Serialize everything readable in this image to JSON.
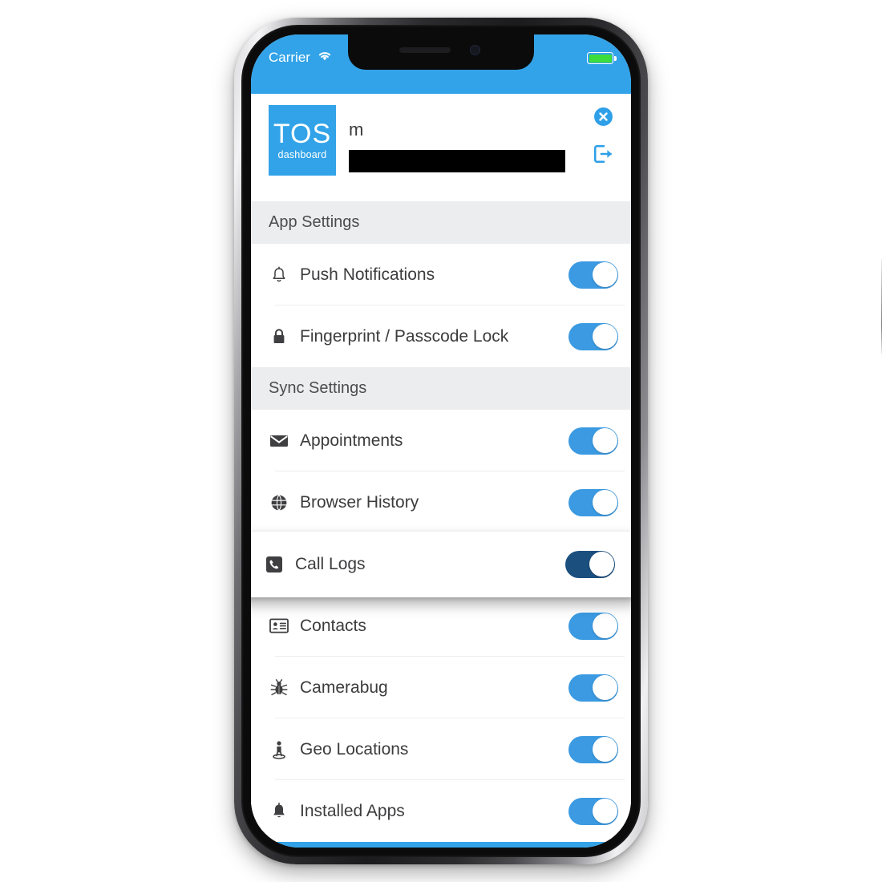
{
  "status_bar": {
    "carrier": "Carrier",
    "wifi_icon": "wifi-icon",
    "battery_icon": "battery-icon",
    "battery_color": "#3ddc3d",
    "background_color": "#32a3e8"
  },
  "header": {
    "logo": {
      "title": "TOS",
      "subtitle": "dashboard",
      "background_color": "#32a3e8"
    },
    "account_name": "m",
    "redacted_field": "",
    "close_icon": "close-circle-icon",
    "logout_icon": "logout-icon",
    "icon_color": "#2f9fe8"
  },
  "sections": [
    {
      "title": "App Settings",
      "rows": [
        {
          "label": "Push Notifications",
          "icon": "bell-outline-icon",
          "toggle_on": true,
          "highlighted": false
        },
        {
          "label": "Fingerprint / Passcode Lock",
          "icon": "lock-icon",
          "toggle_on": true,
          "highlighted": false
        }
      ]
    },
    {
      "title": "Sync Settings",
      "rows": [
        {
          "label": "Appointments",
          "icon": "envelope-icon",
          "toggle_on": true,
          "highlighted": false
        },
        {
          "label": "Browser History",
          "icon": "globe-icon",
          "toggle_on": true,
          "highlighted": false
        },
        {
          "label": "Call Logs",
          "icon": "phone-square-icon",
          "toggle_on": true,
          "highlighted": true
        },
        {
          "label": "Contacts",
          "icon": "id-card-icon",
          "toggle_on": true,
          "highlighted": false
        },
        {
          "label": "Camerabug",
          "icon": "bug-icon",
          "toggle_on": true,
          "highlighted": false
        },
        {
          "label": "Geo Locations",
          "icon": "location-person-icon",
          "toggle_on": true,
          "highlighted": false
        },
        {
          "label": "Installed Apps",
          "icon": "bell-filled-icon",
          "toggle_on": true,
          "highlighted": false
        }
      ]
    }
  ],
  "colors": {
    "accent": "#32a3e8",
    "toggle_on": "#3b9ae1",
    "toggle_focused": "#1b4f7e",
    "section_header_bg": "#ecedef"
  }
}
